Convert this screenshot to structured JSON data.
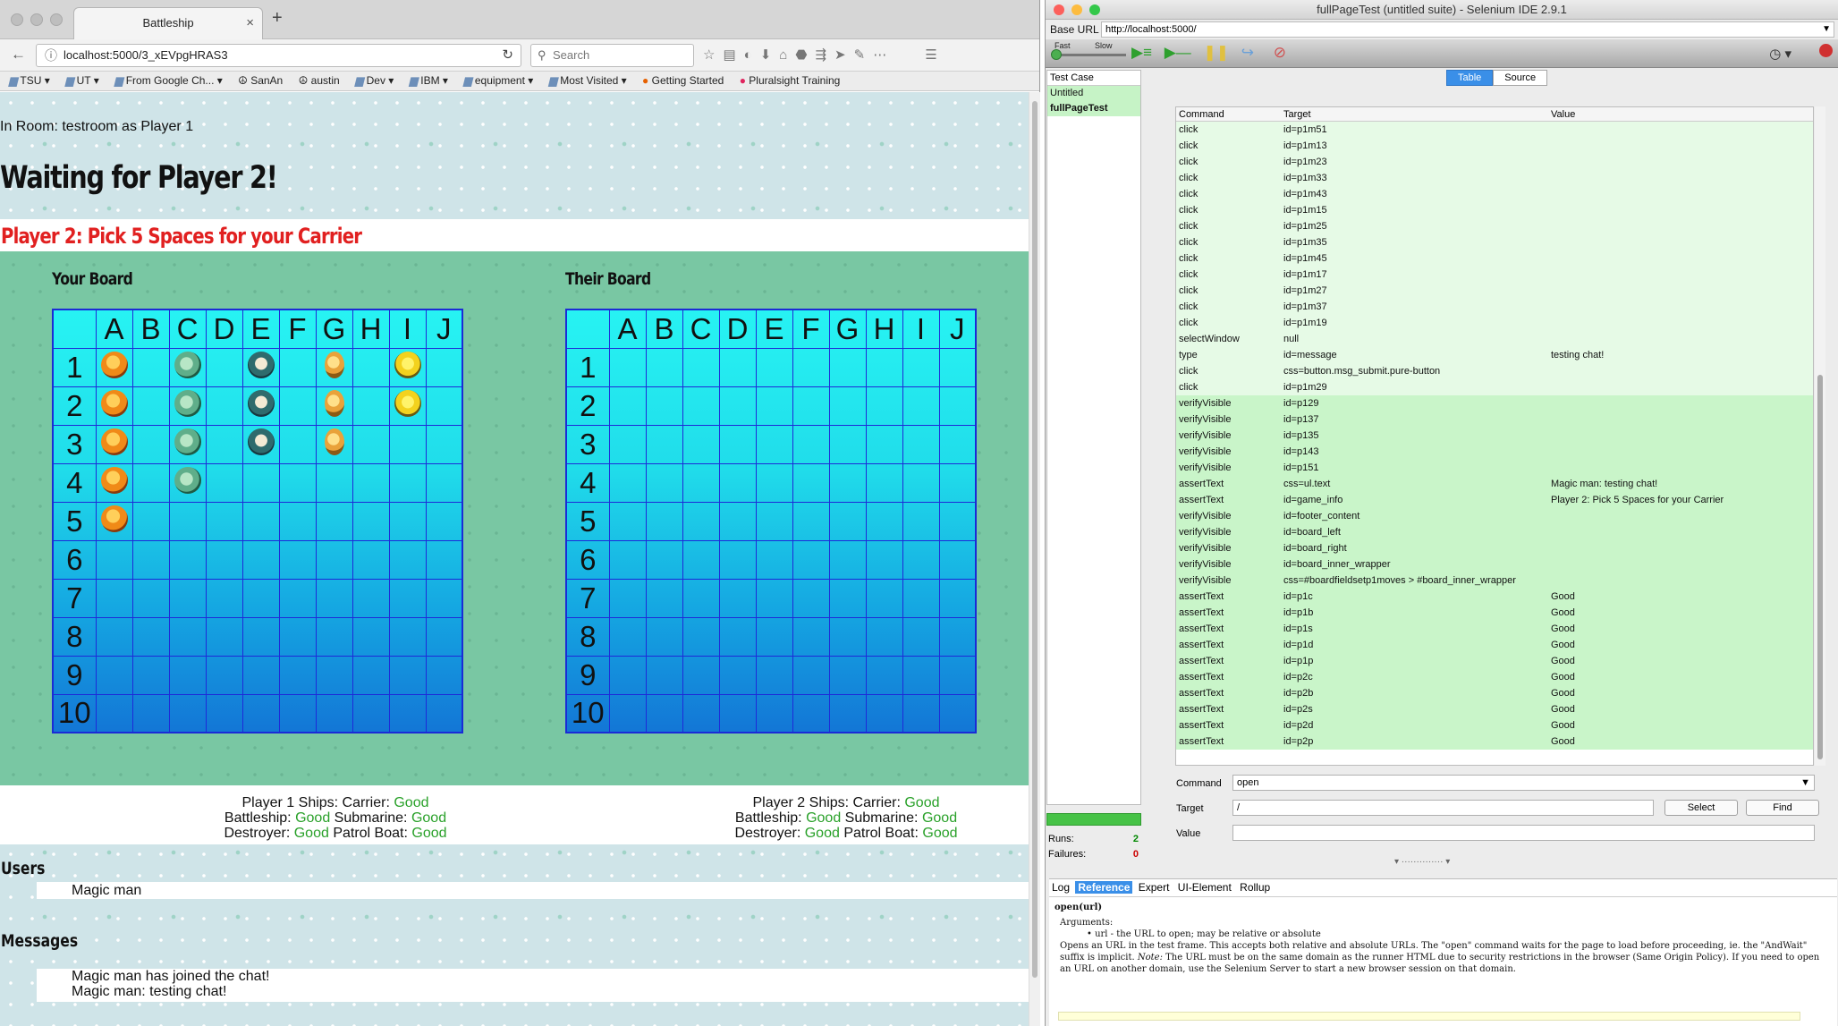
{
  "browser": {
    "tab_title": "Battleship",
    "url": "localhost:5000/3_xEVpgHRAS3",
    "search_placeholder": "Search",
    "bookmarks": [
      "TSU",
      "UT",
      "From Google Ch...",
      "SanAn",
      "austin",
      "Dev",
      "IBM",
      "equipment",
      "Most Visited",
      "Getting Started",
      "Pluralsight Training"
    ]
  },
  "page": {
    "room_info": "In Room: testroom as Player 1",
    "status": "Waiting for Player 2!",
    "game_info": "Player 2: Pick 5 Spaces for your Carrier",
    "your_board_title": "Your Board",
    "their_board_title": "Their Board",
    "columns": [
      "A",
      "B",
      "C",
      "D",
      "E",
      "F",
      "G",
      "H",
      "I",
      "J"
    ],
    "rows": [
      "1",
      "2",
      "3",
      "4",
      "5",
      "6",
      "7",
      "8",
      "9",
      "10"
    ],
    "ships_on_your_board": [
      {
        "name": "Charizard (Carrier)",
        "icon": "charizard-sprite",
        "cells": [
          "A1",
          "A2",
          "A3",
          "A4",
          "A5"
        ]
      },
      {
        "name": "Bulbasaur (Battleship)",
        "icon": "bulbasaur-sprite",
        "cells": [
          "C1",
          "C2",
          "C3",
          "C4"
        ]
      },
      {
        "name": "Snorlax (Submarine)",
        "icon": "snorlax-sprite",
        "cells": [
          "E1",
          "E2",
          "E3"
        ]
      },
      {
        "name": "Dragonite (Destroyer)",
        "icon": "dragonite-sprite",
        "cells": [
          "G1",
          "G2",
          "G3"
        ]
      },
      {
        "name": "Pikachu (Patrol Boat)",
        "icon": "pikachu-sprite",
        "cells": [
          "I1",
          "I2"
        ]
      }
    ],
    "player1_ships": {
      "label1": "Player 1 Ships: Carrier:",
      "carrier": "Good",
      "label2": "Battleship:",
      "battleship": "Good",
      "label3": "Submarine:",
      "submarine": "Good",
      "label4": "Destroyer:",
      "destroyer": "Good",
      "label5": "Patrol Boat:",
      "patrol": "Good"
    },
    "player2_ships": {
      "label1": "Player 2 Ships: Carrier:",
      "carrier": "Good",
      "label2": "Battleship:",
      "battleship": "Good",
      "label3": "Submarine:",
      "submarine": "Good",
      "label4": "Destroyer:",
      "destroyer": "Good",
      "label5": "Patrol Boat:",
      "patrol": "Good"
    },
    "users_heading": "Users",
    "users": [
      "Magic man"
    ],
    "messages_heading": "Messages",
    "messages": [
      "Magic man has joined the chat!",
      "Magic man: testing chat!"
    ]
  },
  "ide": {
    "window_title": "fullPageTest (untitled suite) - Selenium IDE 2.9.1",
    "base_url_label": "Base URL",
    "base_url": "http://localhost:5000/",
    "speed_fast": "Fast",
    "speed_slow": "Slow",
    "testcase_header": "Test Case",
    "testcases": [
      "Untitled",
      "fullPageTest"
    ],
    "tabs": [
      "Table",
      "Source"
    ],
    "columns": [
      "Command",
      "Target",
      "Value"
    ],
    "commands": [
      {
        "c": "click",
        "t": "id=p1m51",
        "v": ""
      },
      {
        "c": "click",
        "t": "id=p1m13",
        "v": ""
      },
      {
        "c": "click",
        "t": "id=p1m23",
        "v": ""
      },
      {
        "c": "click",
        "t": "id=p1m33",
        "v": ""
      },
      {
        "c": "click",
        "t": "id=p1m43",
        "v": ""
      },
      {
        "c": "click",
        "t": "id=p1m15",
        "v": ""
      },
      {
        "c": "click",
        "t": "id=p1m25",
        "v": ""
      },
      {
        "c": "click",
        "t": "id=p1m35",
        "v": ""
      },
      {
        "c": "click",
        "t": "id=p1m45",
        "v": ""
      },
      {
        "c": "click",
        "t": "id=p1m17",
        "v": ""
      },
      {
        "c": "click",
        "t": "id=p1m27",
        "v": ""
      },
      {
        "c": "click",
        "t": "id=p1m37",
        "v": ""
      },
      {
        "c": "click",
        "t": "id=p1m19",
        "v": ""
      },
      {
        "c": "selectWindow",
        "t": "null",
        "v": ""
      },
      {
        "c": "type",
        "t": "id=message",
        "v": "testing chat!"
      },
      {
        "c": "click",
        "t": "css=button.msg_submit.pure-button",
        "v": ""
      },
      {
        "c": "click",
        "t": "id=p1m29",
        "v": ""
      },
      {
        "c": "verifyVisible",
        "t": "id=p129",
        "v": ""
      },
      {
        "c": "verifyVisible",
        "t": "id=p137",
        "v": ""
      },
      {
        "c": "verifyVisible",
        "t": "id=p135",
        "v": ""
      },
      {
        "c": "verifyVisible",
        "t": "id=p143",
        "v": ""
      },
      {
        "c": "verifyVisible",
        "t": "id=p151",
        "v": ""
      },
      {
        "c": "assertText",
        "t": "css=ul.text",
        "v": "Magic man: testing chat!"
      },
      {
        "c": "assertText",
        "t": "id=game_info",
        "v": "Player 2: Pick 5 Spaces for your Carrier"
      },
      {
        "c": "verifyVisible",
        "t": "id=footer_content",
        "v": ""
      },
      {
        "c": "verifyVisible",
        "t": "id=board_left",
        "v": ""
      },
      {
        "c": "verifyVisible",
        "t": "id=board_right",
        "v": ""
      },
      {
        "c": "verifyVisible",
        "t": "id=board_inner_wrapper",
        "v": ""
      },
      {
        "c": "verifyVisible",
        "t": "css=#boardfieldsetp1moves > #board_inner_wrapper",
        "v": ""
      },
      {
        "c": "assertText",
        "t": "id=p1c",
        "v": "Good"
      },
      {
        "c": "assertText",
        "t": "id=p1b",
        "v": "Good"
      },
      {
        "c": "assertText",
        "t": "id=p1s",
        "v": "Good"
      },
      {
        "c": "assertText",
        "t": "id=p1d",
        "v": "Good"
      },
      {
        "c": "assertText",
        "t": "id=p1p",
        "v": "Good"
      },
      {
        "c": "assertText",
        "t": "id=p2c",
        "v": "Good"
      },
      {
        "c": "assertText",
        "t": "id=p2b",
        "v": "Good"
      },
      {
        "c": "assertText",
        "t": "id=p2s",
        "v": "Good"
      },
      {
        "c": "assertText",
        "t": "id=p2d",
        "v": "Good"
      },
      {
        "c": "assertText",
        "t": "id=p2p",
        "v": "Good"
      }
    ],
    "command_label": "Command",
    "command_value": "open",
    "target_label": "Target",
    "target_value": "/",
    "value_label": "Value",
    "value_value": "",
    "select_btn": "Select",
    "find_btn": "Find",
    "runs_label": "Runs:",
    "runs": "2",
    "failures_label": "Failures:",
    "failures": "0",
    "bottom_tabs": [
      "Log",
      "Reference",
      "Expert",
      "UI-Element",
      "Rollup"
    ],
    "ref_title": "open(url)",
    "ref_args": "Arguments:",
    "ref_arg1": "url - the URL to open; may be relative or absolute",
    "ref_text1": "Opens an URL in the test frame. This accepts both relative and absolute URLs. The \"open\" command waits for the page to load before proceeding, ie. the \"AndWait\" suffix is implicit.",
    "ref_note_label": "Note:",
    "ref_text2": "The URL must be on the same domain as the runner HTML due to security restrictions in the browser (Same Origin Policy). If you need to open an URL on another domain, use the Selenium Server to start a new browser session on that domain."
  },
  "colors": {
    "accent_red": "#e12020",
    "good_green": "#2aa12a",
    "board_border": "#1a2bd6",
    "ide_pass_green": "#c9f5c9"
  }
}
